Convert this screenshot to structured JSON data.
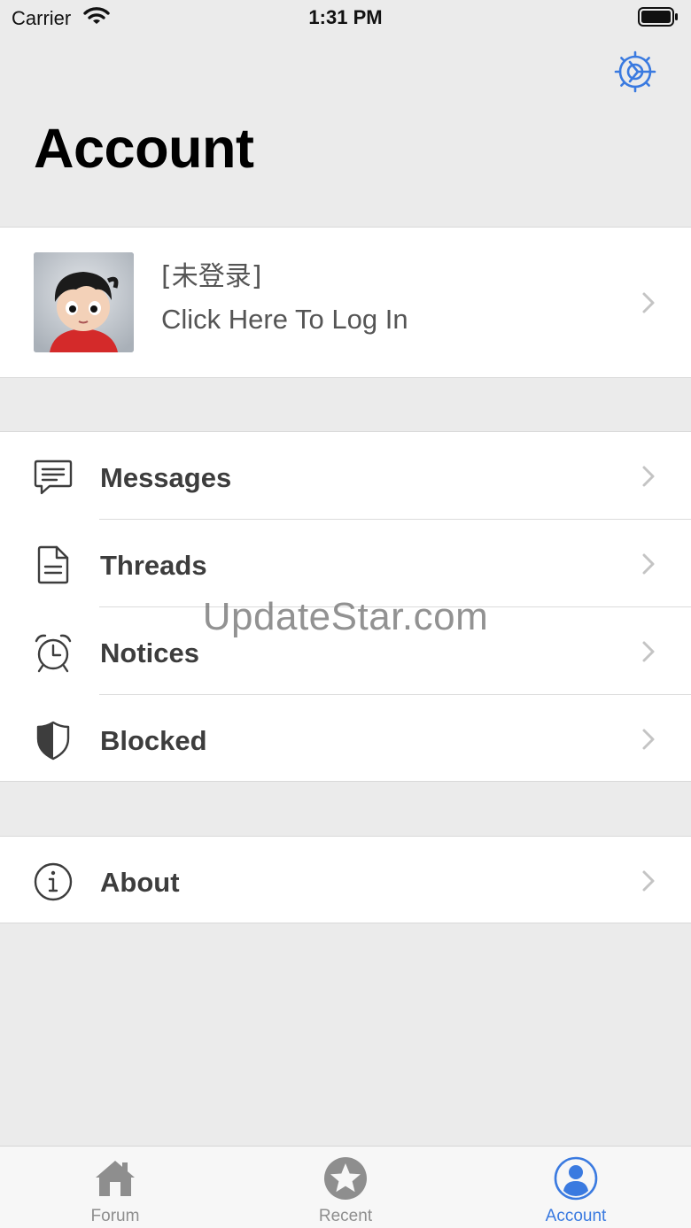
{
  "status_bar": {
    "carrier": "Carrier",
    "time": "1:31 PM"
  },
  "header": {
    "title": "Account",
    "settings_icon": "gear-icon"
  },
  "profile": {
    "name": "[未登录]",
    "subtitle": "Click Here To Log In"
  },
  "menu": {
    "items": [
      {
        "label": "Messages",
        "icon": "chat-bubble-icon"
      },
      {
        "label": "Threads",
        "icon": "document-icon"
      },
      {
        "label": "Notices",
        "icon": "alarm-clock-icon"
      },
      {
        "label": "Blocked",
        "icon": "shield-icon"
      }
    ]
  },
  "about": {
    "label": "About",
    "icon": "info-icon"
  },
  "watermark": "UpdateStar.com",
  "tabs": [
    {
      "label": "Forum",
      "icon": "house-icon",
      "active": false
    },
    {
      "label": "Recent",
      "icon": "star-icon",
      "active": false
    },
    {
      "label": "Account",
      "icon": "person-icon",
      "active": true
    }
  ],
  "colors": {
    "accent": "#3a7ae0",
    "background": "#ebebeb",
    "inactive_tab": "#8e8e8e"
  }
}
